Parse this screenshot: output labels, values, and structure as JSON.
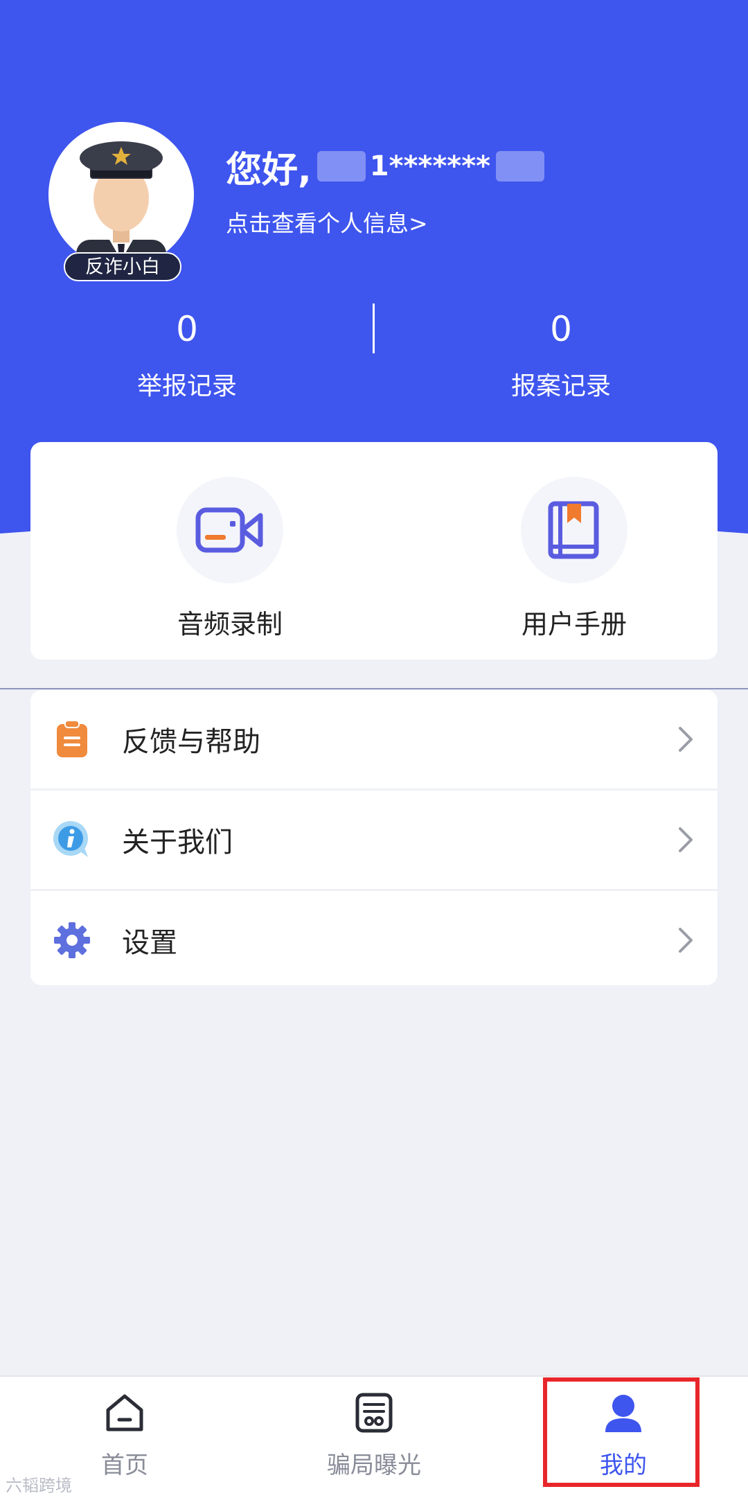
{
  "profile": {
    "greeting": "您好,",
    "masked_phone": "1*******",
    "view_info_link": "点击查看个人信息>",
    "badge": "反诈小白"
  },
  "stats": [
    {
      "value": "0",
      "label": "举报记录"
    },
    {
      "value": "0",
      "label": "报案记录"
    }
  ],
  "tools": [
    {
      "label": "音频录制",
      "icon": "video-camera-icon"
    },
    {
      "label": "用户手册",
      "icon": "book-icon"
    }
  ],
  "menu": [
    {
      "label": "反馈与帮助",
      "icon": "clipboard-icon"
    },
    {
      "label": "关于我们",
      "icon": "info-icon"
    },
    {
      "label": "设置",
      "icon": "gear-icon"
    }
  ],
  "tabbar": [
    {
      "label": "首页",
      "icon": "home-icon"
    },
    {
      "label": "骗局曝光",
      "icon": "newspaper-icon"
    },
    {
      "label": "我的",
      "icon": "user-icon",
      "active": true
    }
  ],
  "watermark": "六韬跨境",
  "colors": {
    "primary": "#3E55EE",
    "background": "#EFF1F7",
    "highlight_box": "#E8262A",
    "tab_inactive": "#888C98"
  }
}
